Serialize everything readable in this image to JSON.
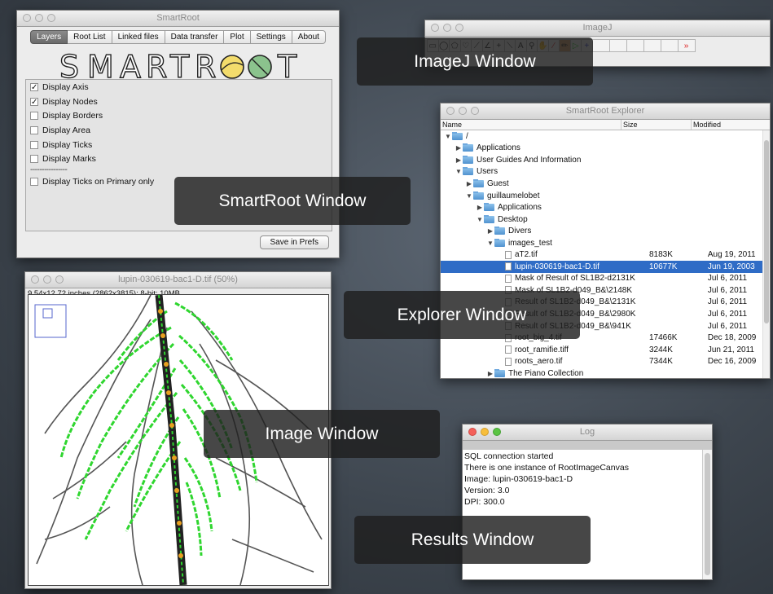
{
  "smartroot": {
    "title": "SmartRoot",
    "tabs": [
      "Layers",
      "Root List",
      "Linked files",
      "Data transfer",
      "Plot",
      "Settings",
      "About"
    ],
    "active_tab": "Layers",
    "logo": "SMARTROOT",
    "options": [
      {
        "label": "Display Axis",
        "checked": true
      },
      {
        "label": "Display Nodes",
        "checked": true
      },
      {
        "label": "Display Borders",
        "checked": false
      },
      {
        "label": "Display Area",
        "checked": false
      },
      {
        "label": "Display Ticks",
        "checked": false
      },
      {
        "label": "Display Marks",
        "checked": false
      }
    ],
    "separator": "----------------",
    "primary_only": {
      "label": "Display Ticks on Primary only",
      "checked": false
    },
    "save_label": "Save in Prefs"
  },
  "imagej": {
    "title": "ImageJ",
    "tools": [
      "rectangle-tool-icon",
      "oval-tool-icon",
      "polygon-tool-icon",
      "freehand-tool-icon",
      "line-tool-icon",
      "angle-tool-icon",
      "point-tool-icon",
      "wand-tool-icon",
      "text-tool-icon",
      "magnifier-tool-icon",
      "hand-tool-icon",
      "eyedropper-tool-icon",
      "root-tool-icon",
      "play-icon",
      "plus-icon",
      "empty-slot-icon",
      "empty-slot-icon",
      "empty-slot-icon",
      "empty-slot-icon",
      "more-tools-icon"
    ]
  },
  "explorer": {
    "title": "SmartRoot Explorer",
    "columns": {
      "name": "Name",
      "size": "Size",
      "modified": "Modified"
    },
    "rows": [
      {
        "name": "/",
        "type": "folder",
        "depth": 0,
        "expanded": true,
        "size": "",
        "modified": ""
      },
      {
        "name": "Applications",
        "type": "folder",
        "depth": 1,
        "expanded": false,
        "size": "",
        "modified": ""
      },
      {
        "name": "User Guides And Information",
        "type": "folder",
        "depth": 1,
        "expanded": false,
        "size": "",
        "modified": ""
      },
      {
        "name": "Users",
        "type": "folder",
        "depth": 1,
        "expanded": true,
        "size": "",
        "modified": ""
      },
      {
        "name": "Guest",
        "type": "folder",
        "depth": 2,
        "expanded": false,
        "size": "",
        "modified": ""
      },
      {
        "name": "guillaumelobet",
        "type": "folder",
        "depth": 2,
        "expanded": true,
        "size": "",
        "modified": ""
      },
      {
        "name": "Applications",
        "type": "folder",
        "depth": 3,
        "expanded": false,
        "size": "",
        "modified": ""
      },
      {
        "name": "Desktop",
        "type": "folder",
        "depth": 3,
        "expanded": true,
        "size": "",
        "modified": ""
      },
      {
        "name": "Divers",
        "type": "folder",
        "depth": 4,
        "expanded": false,
        "size": "",
        "modified": ""
      },
      {
        "name": "images_test",
        "type": "folder",
        "depth": 4,
        "expanded": true,
        "size": "",
        "modified": ""
      },
      {
        "name": "aT2.tif",
        "type": "file",
        "depth": 5,
        "size": "8183K",
        "modified": "Aug 19, 2011"
      },
      {
        "name": "lupin-030619-bac1-D.tif",
        "type": "file",
        "depth": 5,
        "size": "10677K",
        "modified": "Jun 19, 2003",
        "selected": true
      },
      {
        "name": "Mask of Result of SL1B2-d2131K",
        "type": "file",
        "depth": 5,
        "size": "",
        "modified": "Jul 6, 2011"
      },
      {
        "name": "Mask of SL1B2-d049_B&\\2148K",
        "type": "file",
        "depth": 5,
        "size": "",
        "modified": "Jul 6, 2011"
      },
      {
        "name": "Result of SL1B2-d049_B&\\2131K",
        "type": "file",
        "depth": 5,
        "size": "",
        "modified": "Jul 6, 2011"
      },
      {
        "name": "Result of SL1B2-d049_B&\\2980K",
        "type": "file",
        "depth": 5,
        "size": "",
        "modified": "Jul 6, 2011"
      },
      {
        "name": "Result of SL1B2-d049_B&\\941K",
        "type": "file",
        "depth": 5,
        "size": "",
        "modified": "Jul 6, 2011"
      },
      {
        "name": "root_big_4.tif",
        "type": "file",
        "depth": 5,
        "size": "17466K",
        "modified": "Dec 18, 2009"
      },
      {
        "name": "root_ramifie.tiff",
        "type": "file",
        "depth": 5,
        "size": "3244K",
        "modified": "Jun 21, 2011"
      },
      {
        "name": "roots_aero.tif",
        "type": "file",
        "depth": 5,
        "size": "7344K",
        "modified": "Dec 16, 2009"
      },
      {
        "name": "The Piano Collection",
        "type": "folder",
        "depth": 4,
        "expanded": false,
        "size": "",
        "modified": ""
      }
    ]
  },
  "image_window": {
    "title": "lupin-030619-bac1-D.tif (50%)",
    "info": "9.54x12.72 inches (2862x3815); 8-bit; 10MB"
  },
  "log": {
    "title": "Log",
    "lines": [
      "SQL connection started",
      "There is one instance of RootImageCanvas",
      "Image: lupin-030619-bac1-D",
      "Version: 3.0",
      "DPI: 300.0"
    ]
  },
  "callouts": {
    "imagej": "ImageJ Window",
    "smartroot": "SmartRoot Window",
    "explorer": "Explorer Window",
    "image": "Image Window",
    "results": "Results Window"
  },
  "colors": {
    "root_trace": "#2fd62f",
    "root_node": "#e8a020",
    "selection": "#2f6cc6"
  }
}
